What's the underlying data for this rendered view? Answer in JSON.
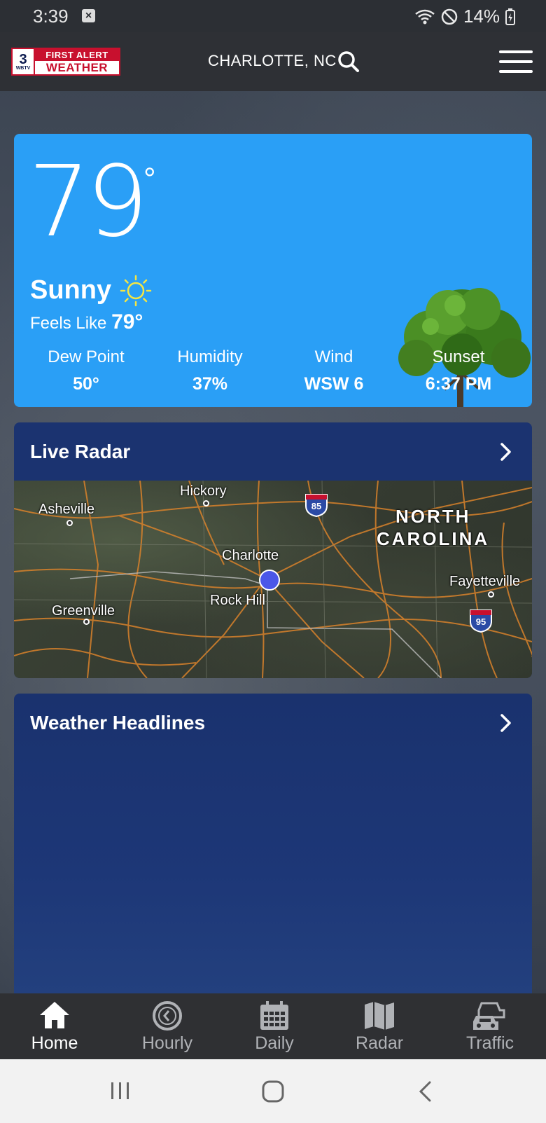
{
  "status_bar": {
    "time": "3:39",
    "battery": "14%"
  },
  "header": {
    "logo": {
      "channel": "3",
      "call_sign": "WBTV",
      "line1": "FIRST ALERT",
      "line2": "WEATHER"
    },
    "location": "CHARLOTTE, NC"
  },
  "current": {
    "temperature": "79",
    "degree_symbol": "°",
    "condition": "Sunny",
    "feels_like_label": "Feels Like",
    "feels_like_value": "79°",
    "stats": [
      {
        "label": "Dew Point",
        "value": "50°"
      },
      {
        "label": "Humidity",
        "value": "37%"
      },
      {
        "label": "Wind",
        "value": "WSW 6"
      },
      {
        "label": "Sunset",
        "value": "6:37 PM"
      }
    ]
  },
  "radar": {
    "title": "Live Radar",
    "map_labels": {
      "hickory": "Hickory",
      "asheville": "Asheville",
      "north": "NORTH",
      "carolina": "CAROLINA",
      "charlotte": "Charlotte",
      "rock_hill": "Rock Hill",
      "greenville": "Greenville",
      "fayetteville": "Fayetteville"
    },
    "shields": [
      "85",
      "95"
    ]
  },
  "headlines": {
    "title": "Weather Headlines"
  },
  "tabs": [
    {
      "label": "Home",
      "icon": "home-icon",
      "active": true
    },
    {
      "label": "Hourly",
      "icon": "clock-icon",
      "active": false
    },
    {
      "label": "Daily",
      "icon": "calendar-icon",
      "active": false
    },
    {
      "label": "Radar",
      "icon": "map-icon",
      "active": false
    },
    {
      "label": "Traffic",
      "icon": "cars-icon",
      "active": false
    }
  ],
  "colors": {
    "card_blue": "#2a9ff6",
    "card_navy": "#1b3370",
    "brand_red": "#c8102e"
  }
}
